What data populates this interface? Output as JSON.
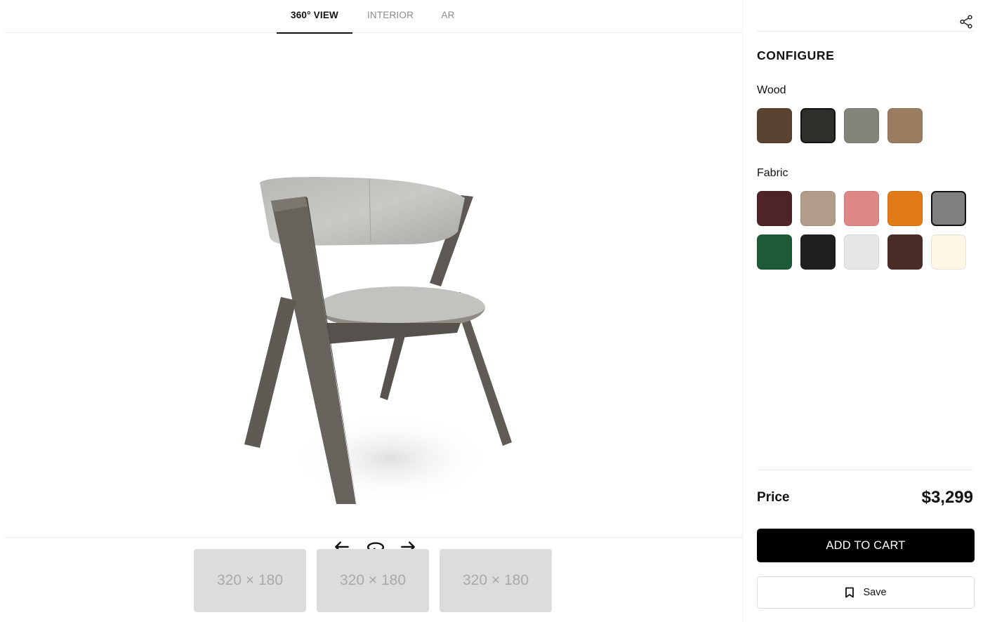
{
  "viewer": {
    "tabs": [
      {
        "label": "360° VIEW",
        "active": true
      },
      {
        "label": "INTERIOR",
        "active": false
      },
      {
        "label": "AR",
        "active": false
      }
    ],
    "controls": {
      "prev_icon": "arrow-left-icon",
      "rotate_icon": "rotate-360-icon",
      "next_icon": "arrow-right-icon"
    },
    "thumbnails": [
      "320 × 180",
      "320 × 180",
      "320 × 180"
    ]
  },
  "panel": {
    "share_icon": "share-icon",
    "title": "CONFIGURE",
    "wood": {
      "label": "Wood",
      "swatches": [
        {
          "color": "#5a4330",
          "selected": false
        },
        {
          "color": "#2f2f2c",
          "selected": true
        },
        {
          "color": "#82837a",
          "selected": false
        },
        {
          "color": "#9a7d60",
          "selected": false
        }
      ]
    },
    "fabric": {
      "label": "Fabric",
      "swatches": [
        {
          "color": "#4e2428",
          "selected": false
        },
        {
          "color": "#b09c89",
          "selected": false
        },
        {
          "color": "#de8886",
          "selected": false
        },
        {
          "color": "#e07b18",
          "selected": false
        },
        {
          "color": "#7f7f7d",
          "selected": true
        },
        {
          "color": "#1f5a38",
          "selected": false
        },
        {
          "color": "#1f1f1f",
          "selected": false
        },
        {
          "color": "#e7e6e4",
          "selected": false
        },
        {
          "color": "#4a2c27",
          "selected": false
        },
        {
          "color": "#fcf6e6",
          "selected": false
        }
      ]
    },
    "price": {
      "label": "Price",
      "value": "$3,299"
    },
    "add_to_cart": "ADD TO CART",
    "save": {
      "label": "Save",
      "icon": "bookmark-icon"
    }
  }
}
